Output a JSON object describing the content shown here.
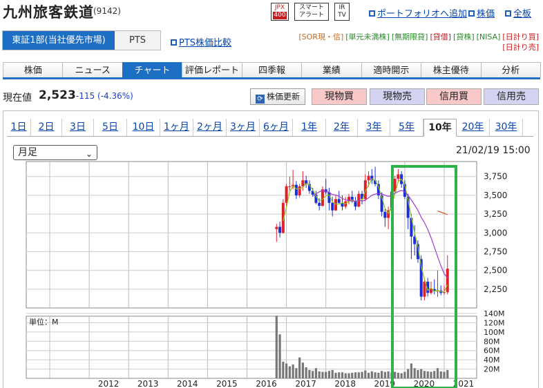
{
  "header": {
    "title": "九州旅客鉄道",
    "code": "(9142)",
    "icons": [
      {
        "name": "jpx400",
        "lines": [
          "JPX",
          "400"
        ]
      },
      {
        "name": "smart-alert",
        "lines": [
          "スマート",
          "アラート"
        ]
      },
      {
        "name": "ir-tv",
        "lines": [
          "IR",
          "TV"
        ]
      }
    ],
    "links": {
      "portfolio": "ポートフォリオへ追加",
      "stock": "株価",
      "board": "全板"
    }
  },
  "market": {
    "primary": "東証1部(当社優先市場)",
    "secondary": "PTS",
    "pts_compare": "PTS株価比較"
  },
  "tags": [
    "[SOR現・信]",
    "[単元未満株]",
    "[無期限貸]",
    "[貸借]",
    "[貸株]",
    "[NISA]",
    "[日計り買]",
    "[日計り売]"
  ],
  "colors": {
    "accent": "#1d6fc4",
    "tag_border": "#c46b1d",
    "tag_green": "#2a8a2a",
    "tag_red": "#c41d1d",
    "highlight": "#2db34a"
  },
  "nav": [
    "株価",
    "ニュース",
    "チャート",
    "評価レポート",
    "四季報",
    "業績",
    "適時開示",
    "株主優待",
    "分析"
  ],
  "nav_active": "チャート",
  "quote": {
    "label": "現在値",
    "price": "2,523",
    "change": "-115 (-4.36%)"
  },
  "buttons": {
    "refresh": "株価更新",
    "spot_buy": "現物買",
    "spot_sell": "現物売",
    "margin_buy": "信用買",
    "margin_sell": "信用売"
  },
  "periods": [
    "1日",
    "2日",
    "3日",
    "5日",
    "10日",
    "1ヶ月",
    "2ヶ月",
    "3ヶ月",
    "6ヶ月",
    "1年",
    "2年",
    "3年",
    "5年",
    "10年",
    "20年",
    "30年"
  ],
  "period_active": "10年",
  "interval": {
    "selected": "月足"
  },
  "datetime": "21/02/19 15:00",
  "chart_data": {
    "type": "candlestick",
    "price_axis": {
      "ticks": [
        "3,750",
        "3,500",
        "3,250",
        "3,000",
        "2,750",
        "2,500",
        "2,250"
      ],
      "ylim": [
        2000,
        3950
      ]
    },
    "volume_axis": {
      "unit_label": "単位：M",
      "ticks": [
        "140M",
        "120M",
        "100M",
        "80M",
        "60M",
        "40M",
        "20M"
      ],
      "ylim": [
        0,
        140
      ]
    },
    "x_labels": [
      "2012",
      "2013",
      "2014",
      "2015",
      "2016",
      "2017",
      "2018",
      "2019",
      "2020",
      "2021"
    ],
    "candles": [
      {
        "t": "2016-10",
        "o": 3050,
        "h": 3120,
        "l": 2880,
        "c": 3080,
        "v": 135
      },
      {
        "t": "2016-11",
        "o": 3080,
        "h": 3150,
        "l": 2940,
        "c": 3000,
        "v": 95
      },
      {
        "t": "2016-12",
        "o": 3000,
        "h": 3450,
        "l": 2990,
        "c": 3400,
        "v": 36
      },
      {
        "t": "2017-01",
        "o": 3400,
        "h": 3650,
        "l": 3350,
        "c": 3620,
        "v": 32
      },
      {
        "t": "2017-02",
        "o": 3620,
        "h": 3750,
        "l": 3560,
        "c": 3620,
        "v": 26
      },
      {
        "t": "2017-03",
        "o": 3620,
        "h": 3840,
        "l": 3580,
        "c": 3640,
        "v": 30
      },
      {
        "t": "2017-04",
        "o": 3640,
        "h": 3690,
        "l": 3450,
        "c": 3500,
        "v": 22
      },
      {
        "t": "2017-05",
        "o": 3500,
        "h": 3650,
        "l": 3470,
        "c": 3620,
        "v": 45
      },
      {
        "t": "2017-06",
        "o": 3620,
        "h": 3820,
        "l": 3560,
        "c": 3700,
        "v": 34
      },
      {
        "t": "2017-07",
        "o": 3700,
        "h": 3760,
        "l": 3600,
        "c": 3650,
        "v": 24
      },
      {
        "t": "2017-08",
        "o": 3650,
        "h": 3700,
        "l": 3520,
        "c": 3560,
        "v": 18
      },
      {
        "t": "2017-09",
        "o": 3560,
        "h": 3600,
        "l": 3480,
        "c": 3510,
        "v": 16
      },
      {
        "t": "2017-10",
        "o": 3510,
        "h": 3560,
        "l": 3380,
        "c": 3400,
        "v": 22
      },
      {
        "t": "2017-11",
        "o": 3400,
        "h": 3460,
        "l": 3300,
        "c": 3360,
        "v": 15
      },
      {
        "t": "2017-12",
        "o": 3360,
        "h": 3620,
        "l": 3350,
        "c": 3580,
        "v": 14
      },
      {
        "t": "2018-01",
        "o": 3580,
        "h": 3720,
        "l": 3510,
        "c": 3540,
        "v": 14
      },
      {
        "t": "2018-02",
        "o": 3540,
        "h": 3600,
        "l": 3300,
        "c": 3400,
        "v": 16
      },
      {
        "t": "2018-03",
        "o": 3400,
        "h": 3480,
        "l": 3220,
        "c": 3300,
        "v": 18
      },
      {
        "t": "2018-04",
        "o": 3300,
        "h": 3500,
        "l": 3290,
        "c": 3450,
        "v": 12
      },
      {
        "t": "2018-05",
        "o": 3450,
        "h": 3560,
        "l": 3380,
        "c": 3400,
        "v": 13
      },
      {
        "t": "2018-06",
        "o": 3400,
        "h": 3500,
        "l": 3300,
        "c": 3350,
        "v": 13
      },
      {
        "t": "2018-07",
        "o": 3350,
        "h": 3480,
        "l": 3320,
        "c": 3420,
        "v": 11
      },
      {
        "t": "2018-08",
        "o": 3420,
        "h": 3520,
        "l": 3380,
        "c": 3480,
        "v": 11
      },
      {
        "t": "2018-09",
        "o": 3480,
        "h": 3560,
        "l": 3400,
        "c": 3420,
        "v": 12
      },
      {
        "t": "2018-10",
        "o": 3420,
        "h": 3480,
        "l": 3300,
        "c": 3350,
        "v": 13
      },
      {
        "t": "2018-11",
        "o": 3350,
        "h": 3560,
        "l": 3340,
        "c": 3520,
        "v": 13
      },
      {
        "t": "2018-12",
        "o": 3520,
        "h": 3560,
        "l": 3380,
        "c": 3450,
        "v": 14
      },
      {
        "t": "2019-01",
        "o": 3450,
        "h": 3780,
        "l": 3420,
        "c": 3700,
        "v": 17
      },
      {
        "t": "2019-02",
        "o": 3700,
        "h": 3820,
        "l": 3620,
        "c": 3760,
        "v": 12
      },
      {
        "t": "2019-03",
        "o": 3760,
        "h": 3850,
        "l": 3650,
        "c": 3700,
        "v": 15
      },
      {
        "t": "2019-04",
        "o": 3700,
        "h": 3880,
        "l": 3620,
        "c": 3650,
        "v": 13
      },
      {
        "t": "2019-05",
        "o": 3650,
        "h": 3700,
        "l": 3450,
        "c": 3500,
        "v": 12
      },
      {
        "t": "2019-06",
        "o": 3500,
        "h": 3540,
        "l": 3220,
        "c": 3280,
        "v": 16
      },
      {
        "t": "2019-07",
        "o": 3280,
        "h": 3320,
        "l": 3080,
        "c": 3200,
        "v": 14
      },
      {
        "t": "2019-08",
        "o": 3200,
        "h": 3350,
        "l": 3050,
        "c": 3300,
        "v": 15
      },
      {
        "t": "2019-09",
        "o": 3300,
        "h": 3600,
        "l": 3280,
        "c": 3550,
        "v": 13
      },
      {
        "t": "2019-10",
        "o": 3550,
        "h": 3760,
        "l": 3530,
        "c": 3720,
        "v": 14
      },
      {
        "t": "2019-11",
        "o": 3720,
        "h": 3850,
        "l": 3680,
        "c": 3780,
        "v": 12
      },
      {
        "t": "2019-12",
        "o": 3780,
        "h": 3820,
        "l": 3600,
        "c": 3650,
        "v": 11
      },
      {
        "t": "2020-01",
        "o": 3650,
        "h": 3700,
        "l": 3450,
        "c": 3480,
        "v": 14
      },
      {
        "t": "2020-02",
        "o": 3480,
        "h": 3520,
        "l": 3050,
        "c": 3200,
        "v": 20
      },
      {
        "t": "2020-03",
        "o": 3200,
        "h": 3250,
        "l": 2650,
        "c": 2950,
        "v": 32
      },
      {
        "t": "2020-04",
        "o": 2950,
        "h": 3100,
        "l": 2700,
        "c": 2850,
        "v": 22
      },
      {
        "t": "2020-05",
        "o": 2850,
        "h": 2900,
        "l": 2600,
        "c": 2650,
        "v": 18
      },
      {
        "t": "2020-06",
        "o": 2650,
        "h": 2700,
        "l": 2100,
        "c": 2150,
        "v": 20
      },
      {
        "t": "2020-07",
        "o": 2150,
        "h": 2400,
        "l": 2100,
        "c": 2350,
        "v": 16
      },
      {
        "t": "2020-08",
        "o": 2350,
        "h": 2400,
        "l": 2150,
        "c": 2200,
        "v": 15
      },
      {
        "t": "2020-09",
        "o": 2200,
        "h": 2350,
        "l": 2180,
        "c": 2250,
        "v": 14
      },
      {
        "t": "2020-10",
        "o": 2250,
        "h": 2380,
        "l": 2180,
        "c": 2220,
        "v": 16
      },
      {
        "t": "2020-11",
        "o": 2220,
        "h": 2500,
        "l": 2150,
        "c": 2230,
        "v": 22
      },
      {
        "t": "2020-12",
        "o": 2230,
        "h": 2300,
        "l": 2170,
        "c": 2200,
        "v": 15
      },
      {
        "t": "2021-01",
        "o": 2200,
        "h": 2300,
        "l": 2170,
        "c": 2210,
        "v": 14
      },
      {
        "t": "2021-02",
        "o": 2210,
        "h": 2700,
        "l": 2180,
        "c": 2523,
        "v": 18
      }
    ]
  }
}
